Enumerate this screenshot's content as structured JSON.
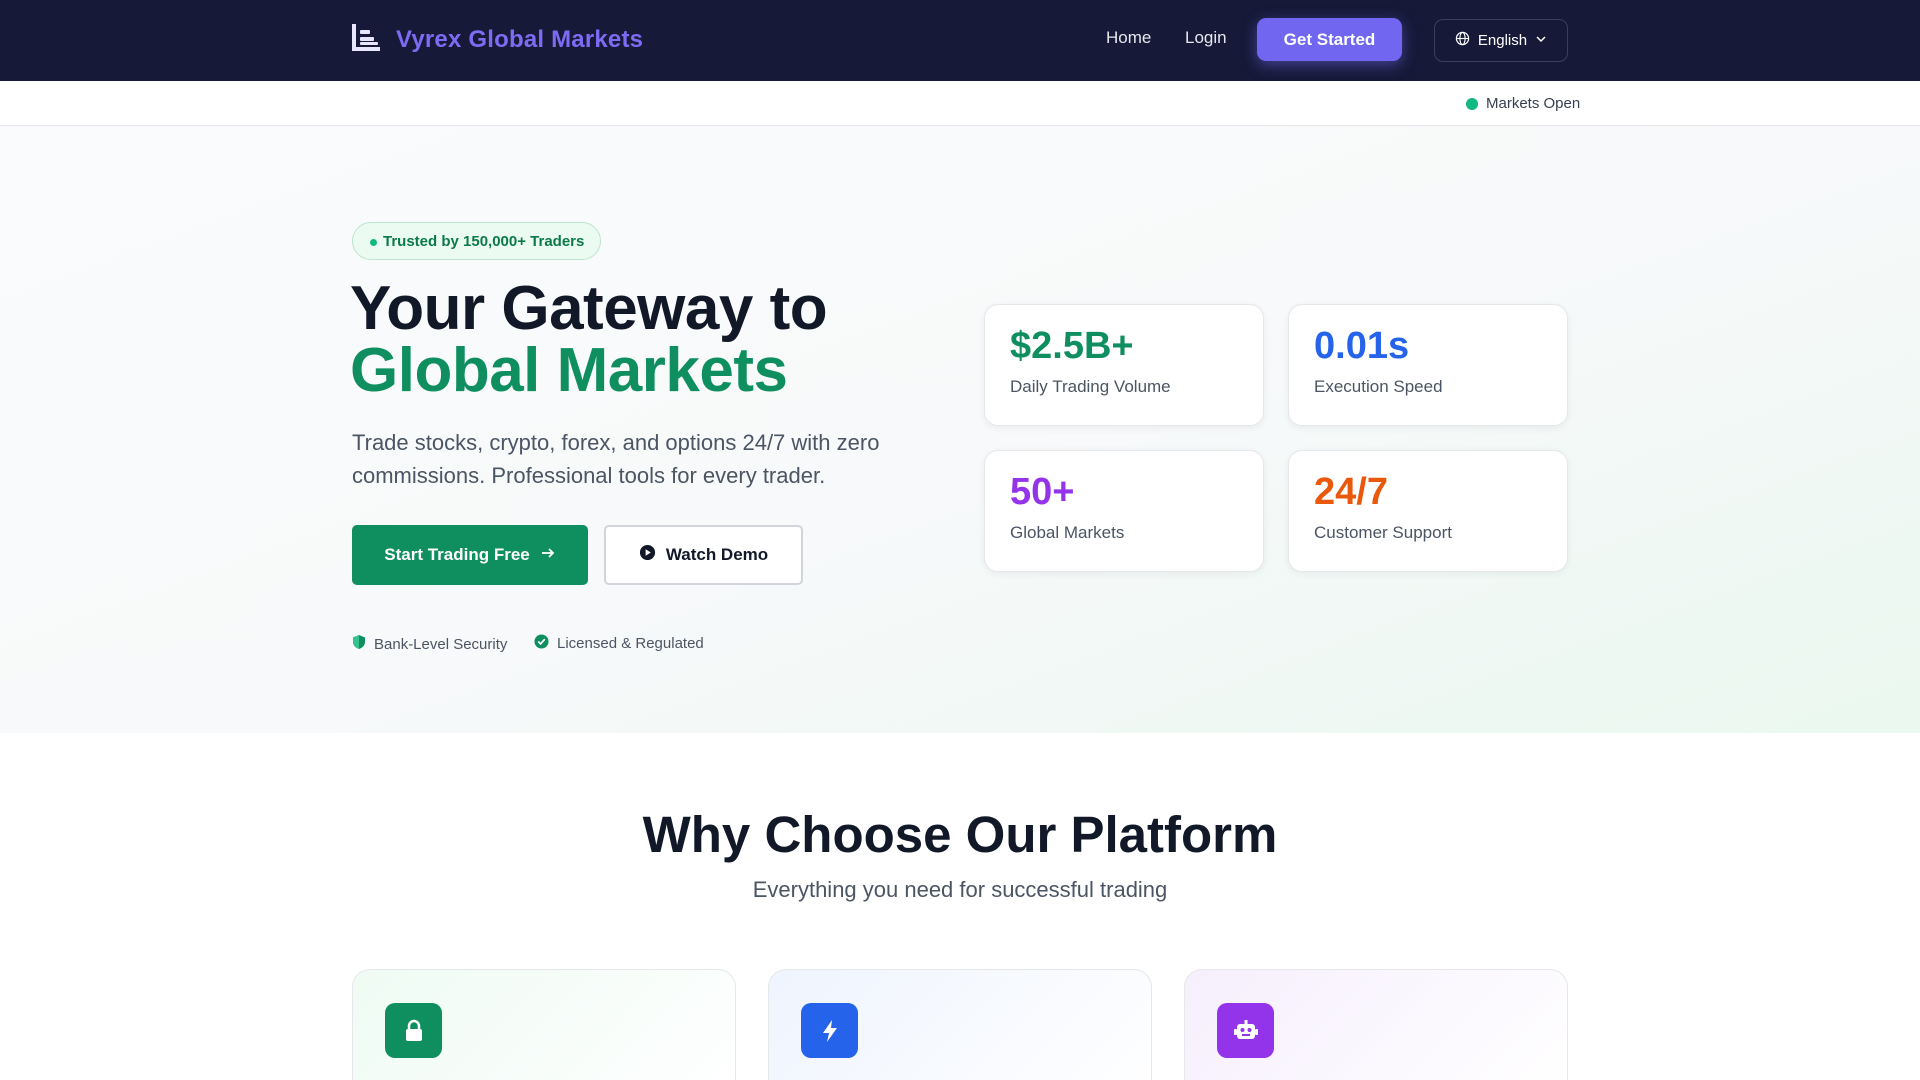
{
  "nav": {
    "brand": "Vyrex Global Markets",
    "links": [
      "Home",
      "Login"
    ],
    "cta": "Get Started",
    "language": "English"
  },
  "ticker": {
    "status": "Markets Open"
  },
  "hero": {
    "badge": "Trusted by 150,000+ Traders",
    "title_line1": "Your Gateway to",
    "title_line2": "Global Markets",
    "subtitle": "Trade stocks, crypto, forex, and options 24/7 with zero commissions. Professional tools for every trader.",
    "primary_button": "Start Trading Free",
    "secondary_button": "Watch Demo",
    "trust": [
      "Bank-Level Security",
      "Licensed & Regulated"
    ]
  },
  "stats": [
    {
      "value": "$2.5B+",
      "label": "Daily Trading Volume",
      "color": "#0f8f5f"
    },
    {
      "value": "0.01s",
      "label": "Execution Speed",
      "color": "#2563eb"
    },
    {
      "value": "50+",
      "label": "Global Markets",
      "color": "#9333ea"
    },
    {
      "value": "24/7",
      "label": "Customer Support",
      "color": "#ea580c"
    }
  ],
  "why": {
    "title": "Why Choose Our Platform",
    "subtitle": "Everything you need for successful trading"
  },
  "features": [
    {
      "icon": "lock-icon",
      "color": "#0f8f5f"
    },
    {
      "icon": "bolt-icon",
      "color": "#2563eb"
    },
    {
      "icon": "robot-icon",
      "color": "#9333ea"
    }
  ]
}
